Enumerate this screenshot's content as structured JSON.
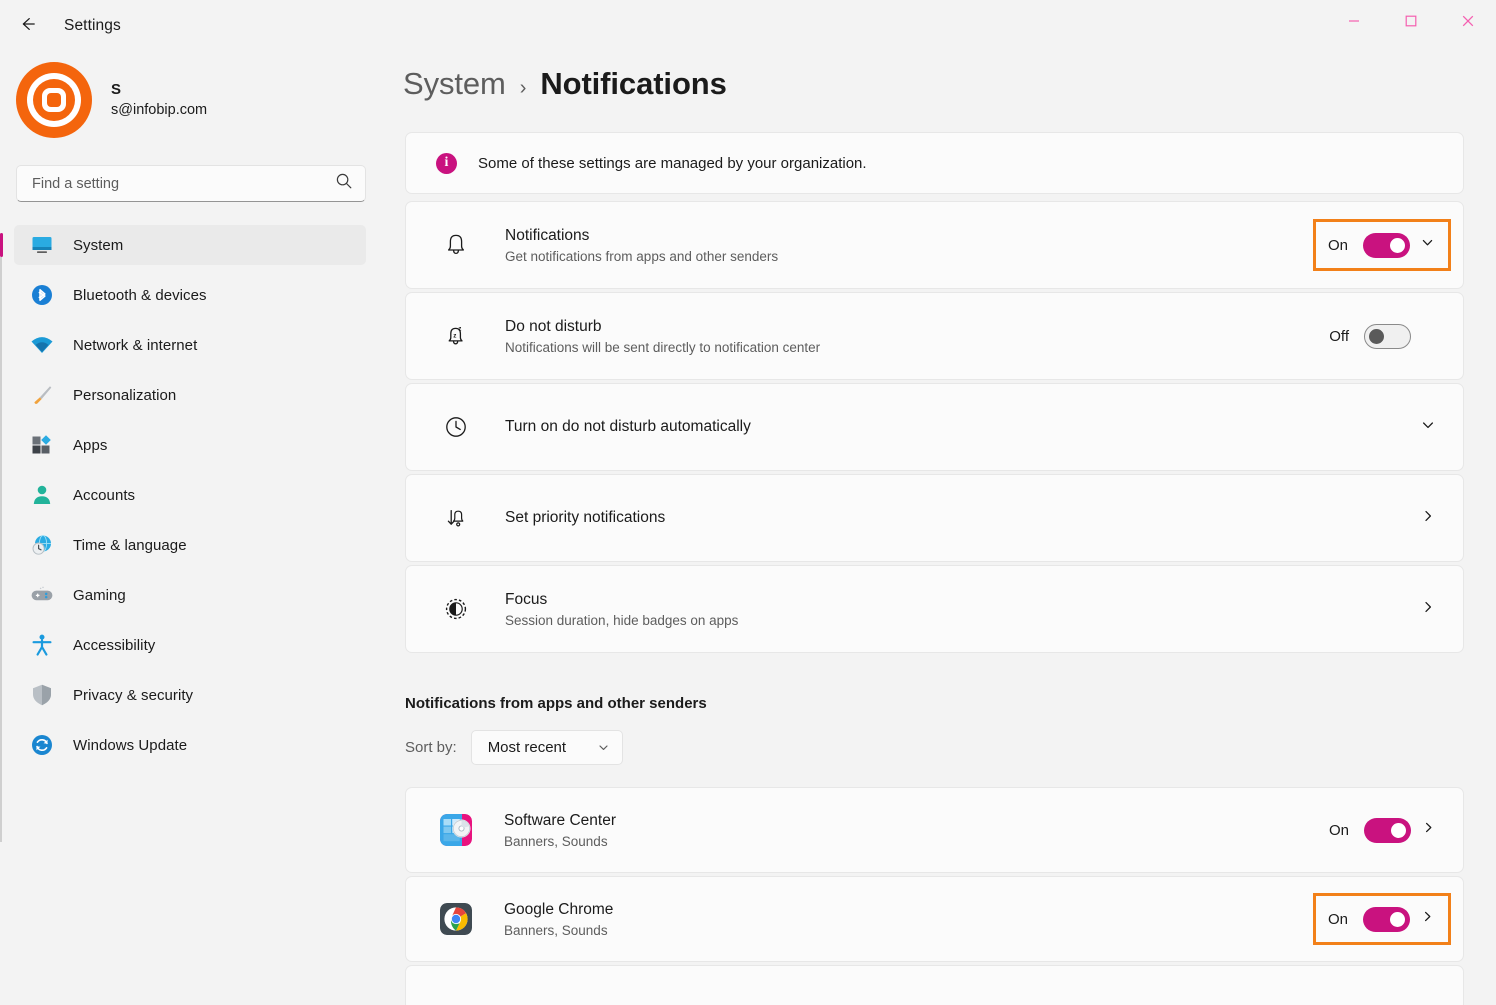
{
  "window": {
    "title": "Settings",
    "back_icon": "back-arrow-icon",
    "minimize_label": "—",
    "maximize_label": "☐",
    "close_label": "✕",
    "accent_color": "#c9127f",
    "highlight_color": "#f28019"
  },
  "account": {
    "name": "S",
    "email": "s@infobip.com"
  },
  "search": {
    "placeholder": "Find a setting",
    "value": "",
    "icon": "search-icon"
  },
  "sidebar": {
    "items": [
      {
        "label": "System",
        "icon": "monitor-icon",
        "selected": true
      },
      {
        "label": "Bluetooth & devices",
        "icon": "bluetooth-icon",
        "selected": false
      },
      {
        "label": "Network & internet",
        "icon": "wifi-icon",
        "selected": false
      },
      {
        "label": "Personalization",
        "icon": "paintbrush-icon",
        "selected": false
      },
      {
        "label": "Apps",
        "icon": "apps-icon",
        "selected": false
      },
      {
        "label": "Accounts",
        "icon": "person-icon",
        "selected": false
      },
      {
        "label": "Time & language",
        "icon": "globe-clock-icon",
        "selected": false
      },
      {
        "label": "Gaming",
        "icon": "gamepad-icon",
        "selected": false
      },
      {
        "label": "Accessibility",
        "icon": "accessibility-icon",
        "selected": false
      },
      {
        "label": "Privacy & security",
        "icon": "shield-icon",
        "selected": false
      },
      {
        "label": "Windows Update",
        "icon": "update-icon",
        "selected": false
      }
    ]
  },
  "breadcrumb": {
    "parent": "System",
    "separator": "›",
    "current": "Notifications"
  },
  "info_banner": {
    "icon": "info-icon",
    "glyph": "i",
    "text": "Some of these settings are managed by your organization."
  },
  "settings": {
    "notifications": {
      "icon": "bell-icon",
      "title": "Notifications",
      "subtitle": "Get notifications from apps and other senders",
      "toggle_state": "On",
      "toggle_on": true,
      "expand_icon": "chevron-down-icon",
      "highlighted": true
    },
    "do_not_disturb": {
      "icon": "bell-sleep-icon",
      "title": "Do not disturb",
      "subtitle": "Notifications will be sent directly to notification center",
      "toggle_state": "Off",
      "toggle_on": false,
      "highlighted": false
    },
    "auto_dnd": {
      "icon": "clock-icon",
      "title": "Turn on do not disturb automatically",
      "expand_icon": "chevron-down-icon"
    },
    "priority": {
      "icon": "priority-icon",
      "title": "Set priority notifications",
      "expand_icon": "chevron-right-icon"
    },
    "focus": {
      "icon": "focus-icon",
      "title": "Focus",
      "subtitle": "Session duration, hide badges on apps",
      "expand_icon": "chevron-right-icon"
    }
  },
  "apps_section": {
    "heading": "Notifications from apps and other senders",
    "sort_label": "Sort by:",
    "sort_value": "Most recent",
    "sort_icon": "chevron-down-icon",
    "apps": [
      {
        "name": "Software Center",
        "subtitle": "Banners, Sounds",
        "icon": "software-center-icon",
        "toggle_state": "On",
        "toggle_on": true,
        "expand_icon": "chevron-right-icon",
        "highlighted": false
      },
      {
        "name": "Google Chrome",
        "subtitle": "Banners, Sounds",
        "icon": "google-chrome-icon",
        "toggle_state": "On",
        "toggle_on": true,
        "expand_icon": "chevron-right-icon",
        "highlighted": true
      }
    ]
  }
}
